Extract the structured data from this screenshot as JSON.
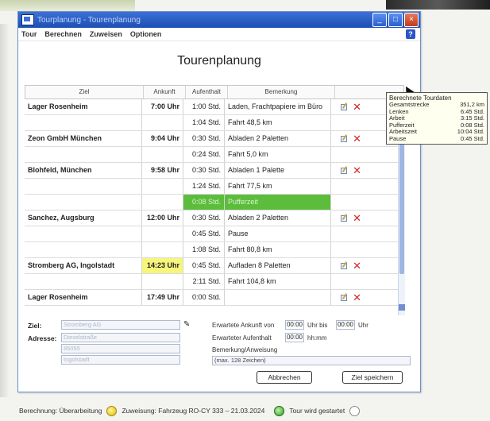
{
  "window": {
    "title": "Tourplanung - Tourenplanung"
  },
  "menu": [
    "Tour",
    "Berechnen",
    "Zuweisen",
    "Optionen"
  ],
  "page_title": "Tourenplanung",
  "table": {
    "headers": [
      "Ziel",
      "Ankunft",
      "Aufenthalt",
      "Bemerkung"
    ],
    "rows": [
      {
        "type": "stop",
        "ziel": "Lager Rosenheim",
        "ankunft": "7:00 Uhr",
        "aufenthalt": "1:00 Std.",
        "bemerkung": "Laden, Fracht­papiere im Büro",
        "highlight": ""
      },
      {
        "type": "drive",
        "ziel": "",
        "ankunft": "",
        "aufenthalt": "1:04 Std.",
        "bemerkung": "Fahrt 48,5 km",
        "highlight": ""
      },
      {
        "type": "stop",
        "ziel": "Zeon GmbH München",
        "ankunft": "9:04 Uhr",
        "aufenthalt": "0:30 Std.",
        "bemerkung": "Abladen 2 Paletten",
        "highlight": ""
      },
      {
        "type": "drive",
        "ziel": "",
        "ankunft": "",
        "aufenthalt": "0:24 Std.",
        "bemerkung": "Fahrt 5,0 km",
        "highlight": ""
      },
      {
        "type": "stop",
        "ziel": "Blohfeld, München",
        "ankunft": "9:58 Uhr",
        "aufenthalt": "0:30 Std.",
        "bemerkung": "Abladen 1 Palette",
        "highlight": ""
      },
      {
        "type": "drive",
        "ziel": "",
        "ankunft": "",
        "aufenthalt": "1:24 Std.",
        "bemerkung": "Fahrt 77,5 km",
        "highlight": ""
      },
      {
        "type": "pause",
        "ziel": "",
        "ankunft": "",
        "aufenthalt": "0:08 Std.",
        "bemerkung": "Pufferzeit",
        "highlight": "green"
      },
      {
        "type": "stop",
        "ziel": "Sanchez, Augsburg",
        "ankunft": "12:00 Uhr",
        "aufenthalt": "0:30 Std.",
        "bemerkung": "Abladen 2 Paletten",
        "highlight": ""
      },
      {
        "type": "drive",
        "ziel": "",
        "ankunft": "",
        "aufenthalt": "0:45 Std.",
        "bemerkung": "Pause",
        "highlight": ""
      },
      {
        "type": "drive",
        "ziel": "",
        "ankunft": "",
        "aufenthalt": "1:08 Std.",
        "bemerkung": "Fahrt 80,8 km",
        "highlight": ""
      },
      {
        "type": "stop",
        "ziel": "Stromberg AG, Ingolstadt",
        "ankunft": "14:23 Uhr",
        "aufenthalt": "0:45 Std.",
        "bemerkung": "Aufladen 8 Paletten",
        "highlight": "yellow"
      },
      {
        "type": "drive",
        "ziel": "",
        "ankunft": "",
        "aufenthalt": "2:11 Std.",
        "bemerkung": "Fahrt 104,8 km",
        "highlight": ""
      },
      {
        "type": "stop",
        "ziel": "Lager Rosenheim",
        "ankunft": "17:49 Uhr",
        "aufenthalt": "0:00 Std.",
        "bemerkung": "",
        "highlight": ""
      }
    ]
  },
  "tooltip": {
    "title": "Berechnete Tourdaten",
    "rows": [
      {
        "label": "Gesamtstrecke",
        "value": "351,2 km"
      },
      {
        "label": "Lenken",
        "value": "6:45 Std."
      },
      {
        "label": "Arbeit",
        "value": "3:15 Std."
      },
      {
        "label": "Pufferzeit",
        "value": "0:08 Std."
      },
      {
        "label": "Arbeitszeit",
        "value": "10:04 Std."
      },
      {
        "label": "Pause",
        "value": "0:45 Std."
      }
    ]
  },
  "form": {
    "ziel_label": "Ziel:",
    "ziel_placeholder": "Stromberg AG",
    "adresse_label": "Adresse:",
    "adresse_line1": "Dieselstraße",
    "adresse_line2": "85055",
    "adresse_line3": "Ingolstadt",
    "erw_ankunft_label": "Erwartete Ankunft von",
    "ankunft_von": "00:00",
    "uhr_bis_label": "Uhr bis",
    "ankunft_bis": "00:00",
    "uhr_label": "Uhr",
    "erw_aufenthalt_label": "Erwarteter Aufenthalt",
    "aufenthalt_value": "00:00",
    "std_label": "hh:mm",
    "bemerkung_label": "Bemerkung/Anweisung",
    "bemerkung_value": "(max. 128 Zeichen)",
    "cancel_label": "Abbrechen",
    "save_label": "Ziel speichern"
  },
  "statusbar": {
    "berechnung": "Berechnung: Überarbeitung",
    "zuweisung": "Zuweisung: Fahrzeug RO-CY 333 – 21.03.2024",
    "status": "Tour wird gestartet"
  }
}
